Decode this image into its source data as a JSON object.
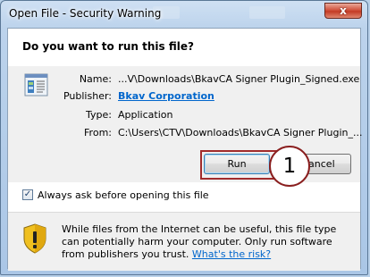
{
  "window": {
    "title": "Open File - Security Warning",
    "close_label": "x"
  },
  "question": "Do you want to run this file?",
  "fields": [
    {
      "label": "Name:",
      "value": "...V\\Downloads\\BkavCA Signer Plugin_Signed.exe",
      "is_link": false
    },
    {
      "label": "Publisher:",
      "value": "Bkav Corporation",
      "is_link": true
    },
    {
      "label": "Type:",
      "value": "Application",
      "is_link": false
    },
    {
      "label": "From:",
      "value": "C:\\Users\\CTV\\Downloads\\BkavCA Signer Plugin_...",
      "is_link": false
    }
  ],
  "buttons": {
    "run": "Run",
    "cancel": "Cancel"
  },
  "callout": {
    "number": "1"
  },
  "checkbox": {
    "label": "Always ask before opening this file",
    "checked": true,
    "mark": "✓"
  },
  "warning": {
    "text": "While files from the Internet can be useful, this file type can potentially harm your computer. Only run software from publishers you trust.",
    "link": "What's the risk?"
  },
  "colors": {
    "accent_link": "#0066cc",
    "highlight": "#a12b2b",
    "close_button": "#c33b25"
  }
}
